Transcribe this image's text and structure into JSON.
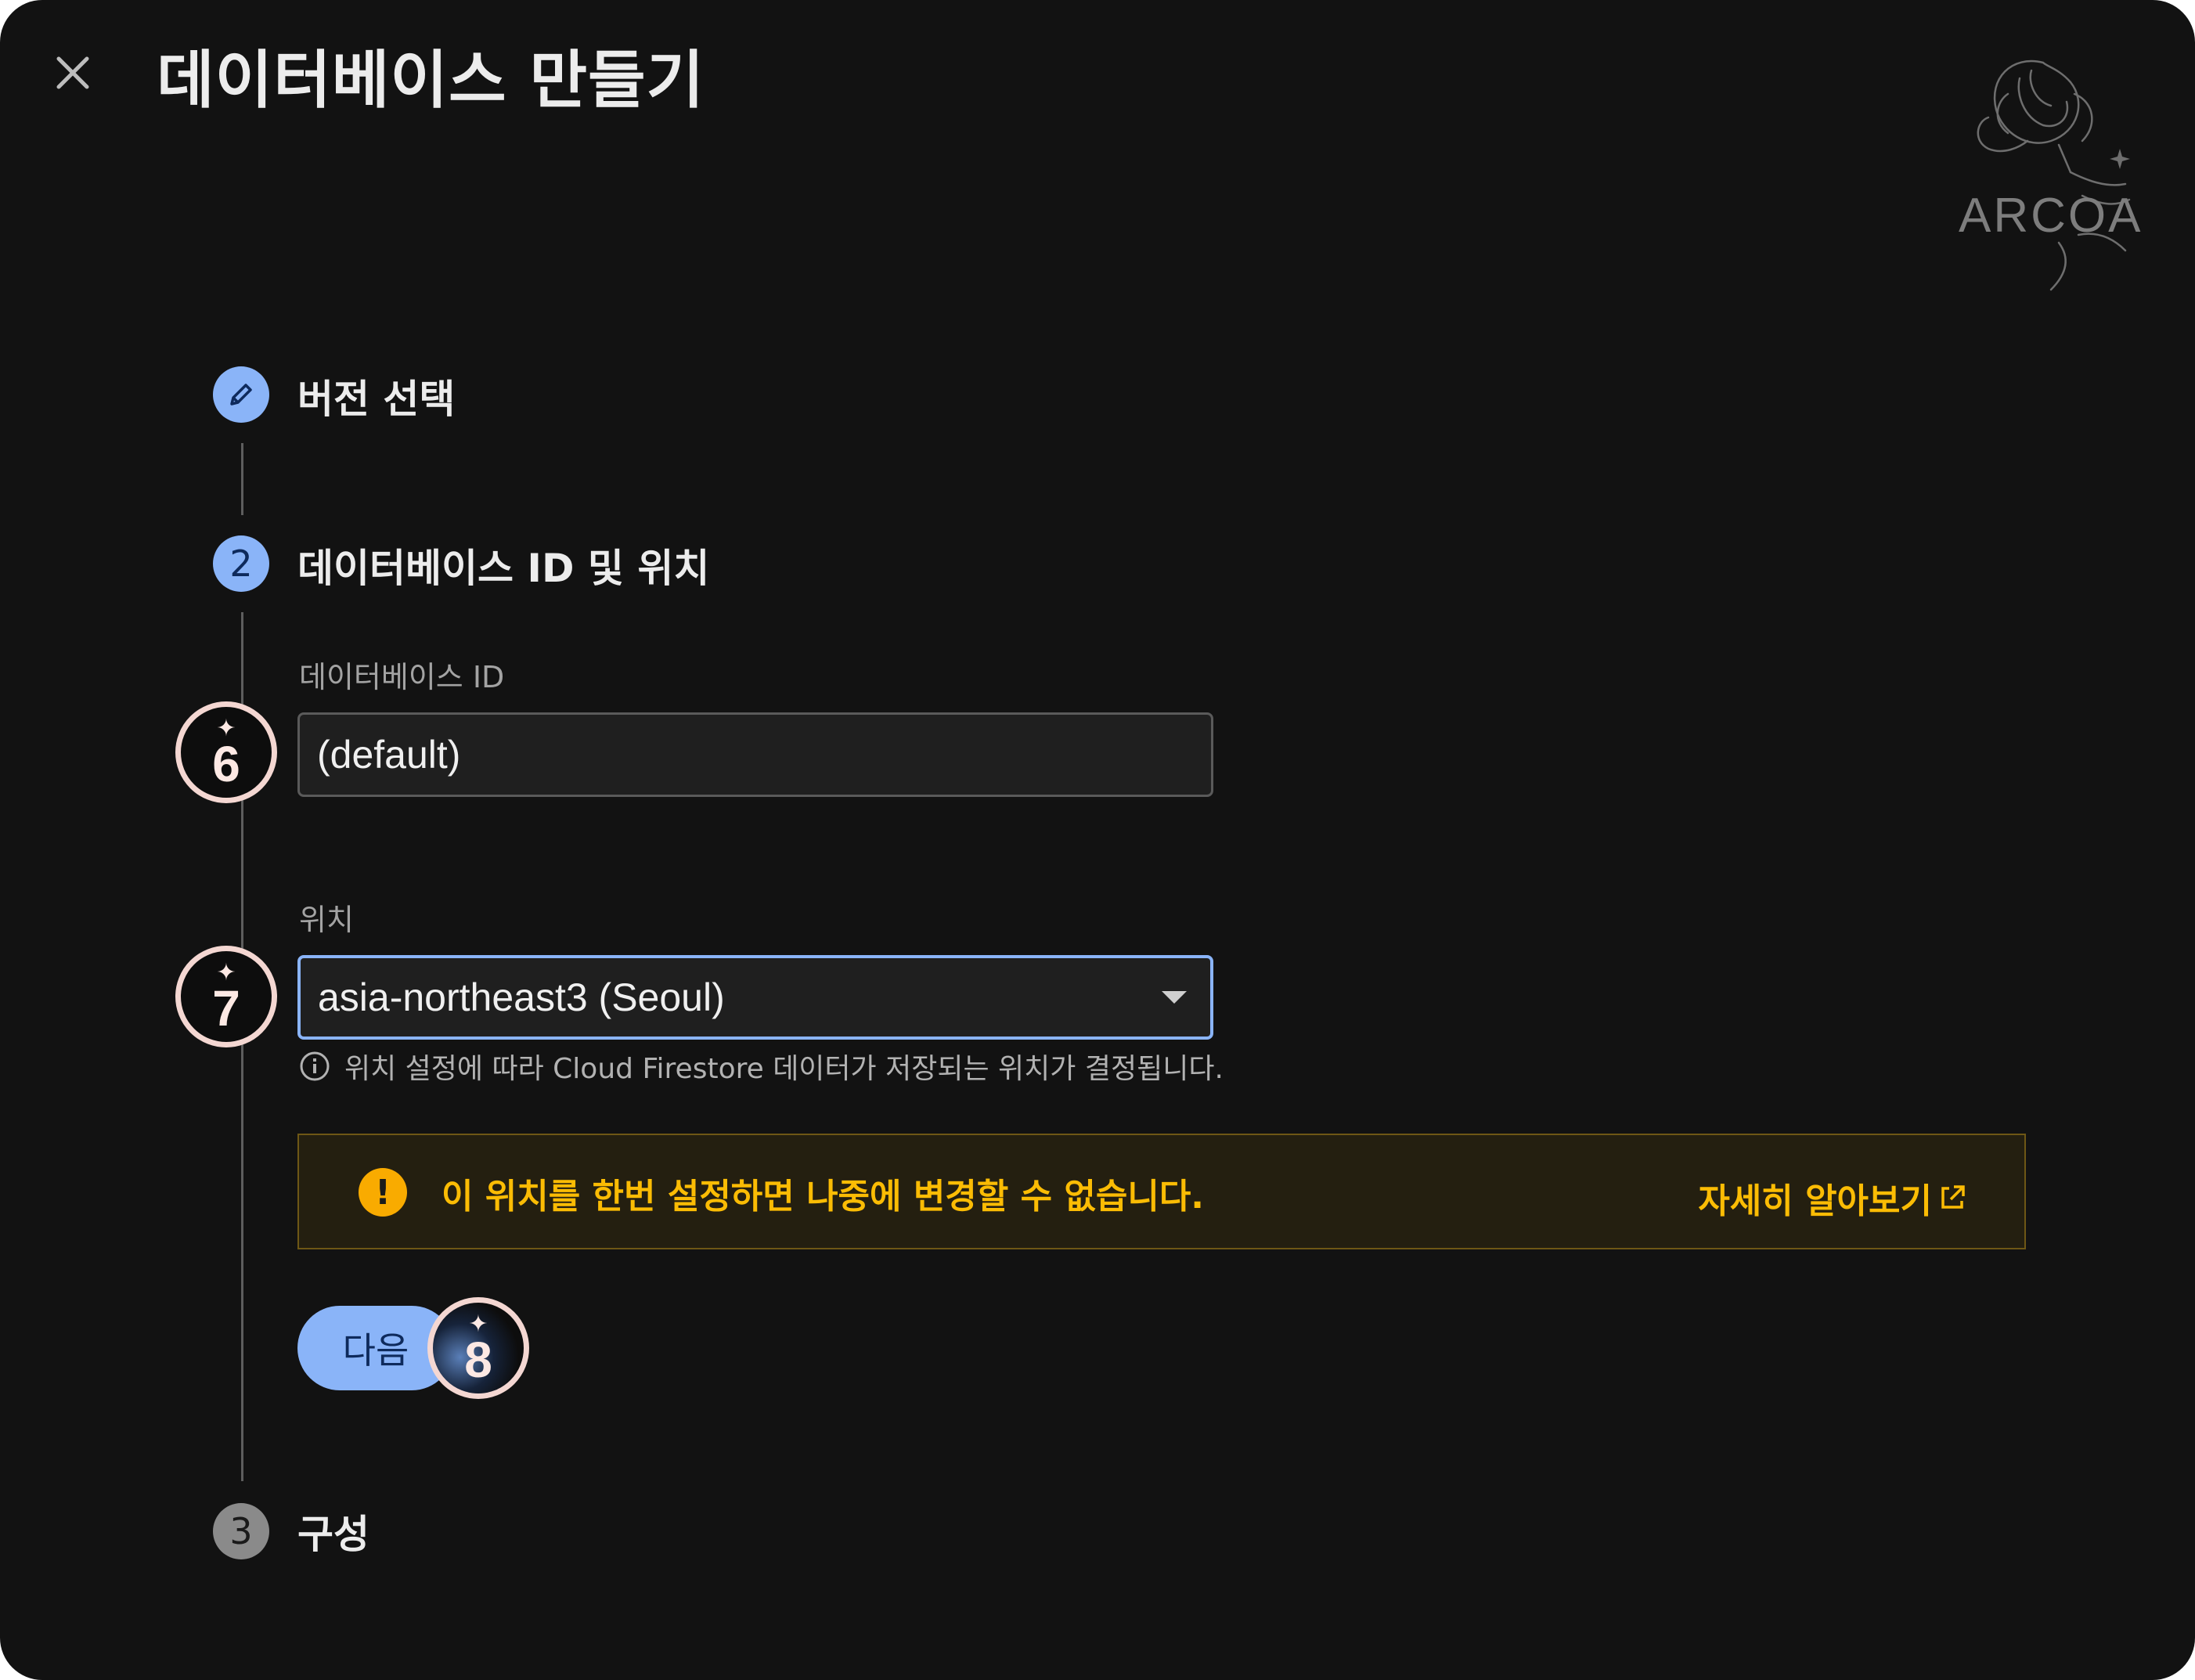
{
  "dialog": {
    "title": "데이터베이스 만들기",
    "logo_text": "ARCOA"
  },
  "steps": [
    {
      "number": "",
      "label": "버전 선택",
      "state": "completed"
    },
    {
      "number": "2",
      "label": "데이터베이스 ID 및 위치",
      "state": "active"
    },
    {
      "number": "3",
      "label": "구성",
      "state": "pending"
    }
  ],
  "form": {
    "database_id": {
      "label": "데이터베이스 ID",
      "value": "(default)"
    },
    "location": {
      "label": "위치",
      "selected": "asia-northeast3 (Seoul)",
      "hint": "위치 설정에 따라 Cloud Firestore 데이터가 저장되는 위치가 결정됩니다."
    },
    "warning": {
      "text": "이 위치를 한번 설정하면 나중에 변경할 수 없습니다.",
      "link_label": "자세히 알아보기"
    },
    "next_button": "다음"
  },
  "annotations": [
    "6",
    "7",
    "8"
  ],
  "colors": {
    "background": "#121212",
    "accent_blue": "#8ab4f8",
    "warning_amber": "#fbbc04",
    "badge_ring": "#f4d7d2"
  }
}
